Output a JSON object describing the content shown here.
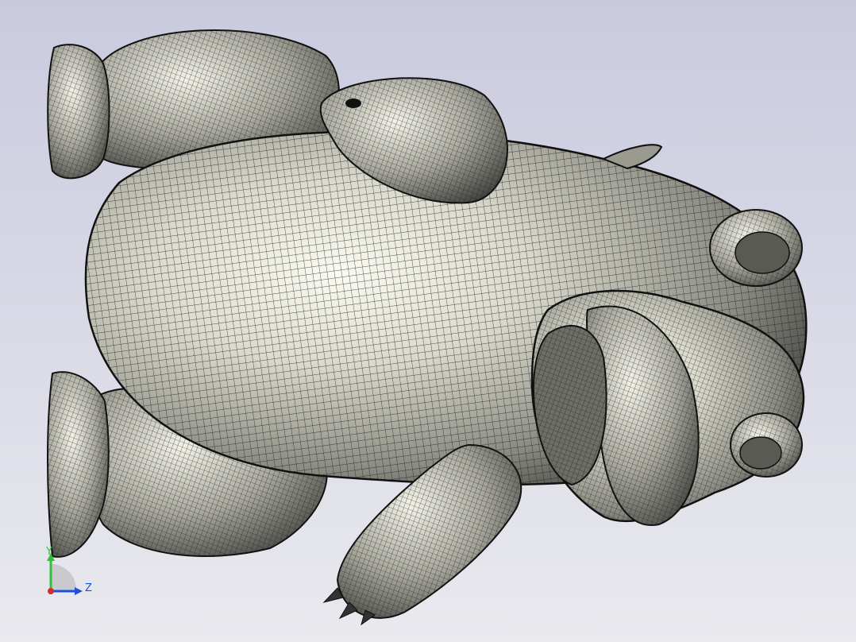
{
  "viewport": {
    "background_top": "#c9cade",
    "background_bottom": "#e9e9ee",
    "model_fill": "#c8c8bc",
    "mesh_color": "#1c1c1c"
  },
  "triad": {
    "y_label": "Y",
    "z_label": "Z",
    "y_color": "#2fbf3a",
    "z_color": "#1f4fd6",
    "origin_color": "#d42b2b"
  }
}
